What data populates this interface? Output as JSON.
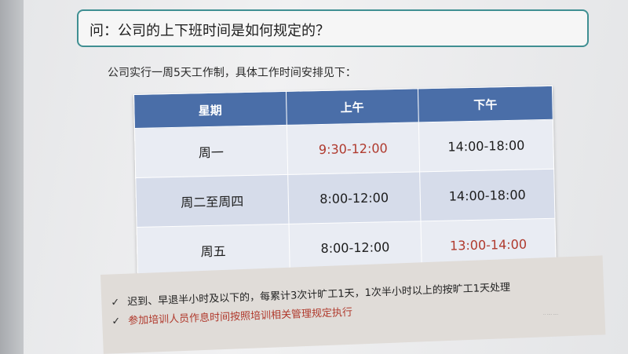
{
  "question": "问：公司的上下班时间是如何规定的？",
  "intro": "公司实行一周5天工作制，具体工作时间安排见下：",
  "table": {
    "headers": [
      "星期",
      "上午",
      "下午"
    ],
    "rows": [
      {
        "day": "周一",
        "am": "9:30-12:00",
        "pm": "14:00-18:00"
      },
      {
        "day": "周二至周四",
        "am": "8:00-12:00",
        "pm": "14:00-18:00"
      },
      {
        "day": "周五",
        "am": "8:00-12:00",
        "pm": "13:00-14:00"
      }
    ]
  },
  "notes": [
    "迟到、早退半小时及以下的，每累计3次计旷工1天，1次半小时以上的按旷工1天处理",
    "参加培训人员作息时间按照培训相关管理规定执行"
  ],
  "footer": "·· ···· ····"
}
